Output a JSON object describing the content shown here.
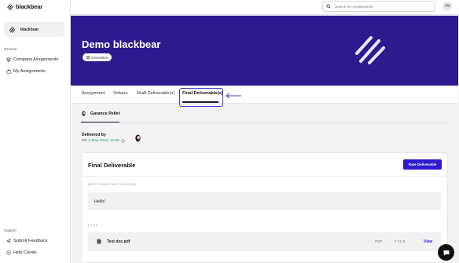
{
  "app": {
    "brand_name": "blackbear"
  },
  "sidebar": {
    "workspace_label": "blackbear",
    "general_title": "General",
    "nav": [
      {
        "label": "Company Assignments",
        "icon": "layers-icon"
      },
      {
        "label": "My Assignments",
        "icon": "briefcase-icon"
      }
    ],
    "support_title": "Support",
    "support_nav": [
      {
        "label": "Submit Feedback",
        "icon": "send-icon"
      },
      {
        "label": "Help Center",
        "icon": "help-circle-icon"
      }
    ]
  },
  "topbar": {
    "search_placeholder": "Search for Assignments",
    "user_initials": "JM"
  },
  "banner": {
    "title": "Demo blackbear",
    "tag": "Innovation",
    "background_color": "#2e1a8f"
  },
  "tabs": [
    {
      "label": "Assignment"
    },
    {
      "label": "Solvers"
    },
    {
      "label": "Draft Deliverable(s)"
    },
    {
      "label": "Final Deliverable(s)",
      "active": true
    }
  ],
  "solver": {
    "name": "Garance Pellet"
  },
  "delivered": {
    "label": "Delivered by",
    "on_prefix": "On",
    "date": "3 May 2023, 11:08"
  },
  "card": {
    "title": "Final Deliverable",
    "rate_button": "Rate Deliverable",
    "note_label": "NOTE FROM THE SOLVER(S)",
    "note_text": "Hello!",
    "files_label": "FILES",
    "files": [
      {
        "name": "Test doc.pdf",
        "type": "PDF",
        "size": "7.71 B",
        "action": "View"
      }
    ]
  },
  "colors": {
    "accent": "#2e1ad1",
    "success": "#2aa05a"
  }
}
